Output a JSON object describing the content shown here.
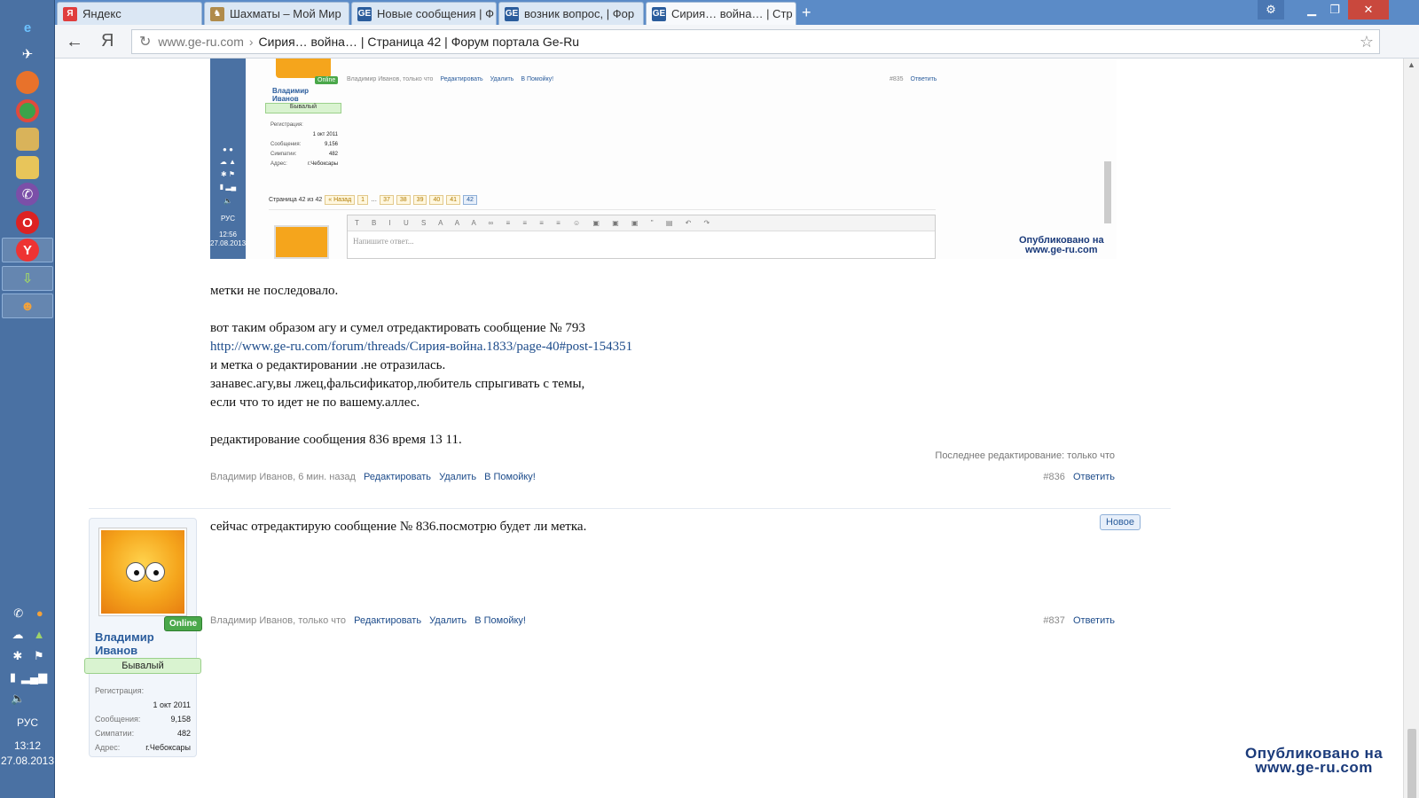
{
  "browser": {
    "tabs": [
      {
        "label": "Яндекс",
        "favicon": "Я",
        "favicon_color": "#e03d3d"
      },
      {
        "label": "Шахматы – Мой Мир",
        "favicon": "♞",
        "favicon_color": "#b08b4b"
      },
      {
        "label": "Новые сообщения | Ф",
        "favicon": "GE",
        "favicon_color": "#2a5c9c"
      },
      {
        "label": "возник вопрос, | Фор",
        "favicon": "GE",
        "favicon_color": "#2a5c9c"
      },
      {
        "label": "Сирия… война… | Стр",
        "favicon": "GE",
        "favicon_color": "#2a5c9c",
        "close": "✕"
      }
    ],
    "new_tab": "+",
    "address": {
      "domain": "www.ge-ru.com",
      "separator": "›",
      "title": "Сирия… война… | Страница 42 | Форум портала Ge-Ru"
    }
  },
  "taskbar": {
    "language": "РУС",
    "time": "13:12",
    "date": "27.08.2013"
  },
  "embedded": {
    "online": "Online",
    "name": "Владимир Иванов",
    "rank": "Бывалый",
    "stats": [
      {
        "label": "Регистрация:",
        "value": "1 окт 2011"
      },
      {
        "label": "Сообщения:",
        "value": "9,156"
      },
      {
        "label": "Симпатии:",
        "value": "482"
      },
      {
        "label": "Адрес:",
        "value": "г.Чебоксары"
      }
    ],
    "meta": "Владимир Иванов, только что",
    "edit": "Редактировать",
    "delete": "Удалить",
    "help": "В Помойку!",
    "post_num": "#835",
    "reply": "Ответить",
    "pager_label": "Страница 42 из 42",
    "pager_prev": "« Назад",
    "pages": [
      "1",
      "…",
      "37",
      "38",
      "39",
      "40",
      "41",
      "42"
    ],
    "placeholder": "Напишите ответ...",
    "language": "РУС",
    "time": "12:56",
    "date": "27.08.2013",
    "watermark_line1": "Опубликовано на",
    "watermark_line2": "www.ge-ru.com"
  },
  "post1": {
    "lines": [
      "метки не последовало.",
      "",
      "вот таким образом агу и сумел отредактировать сообщение № 793"
    ],
    "link": "http://www.ge-ru.com/forum/threads/Сирия-война.1833/page-40#post-154351",
    "lines2": [
      "и метка о редактировании .не отразилась.",
      "занавес.агу,вы лжец,фальсификатор,любитель спрыгивать с темы,",
      "если что то идет не по вашему.аллес.",
      "",
      "редактирование сообщения 836 время 13 11."
    ],
    "last_edit": "Последнее редактирование: только что",
    "meta": "Владимир Иванов, 6 мин. назад",
    "edit": "Редактировать",
    "delete": "Удалить",
    "help": "В Помойку!",
    "post_num": "#836",
    "reply": "Ответить"
  },
  "post2": {
    "text": "сейчас отредактирую сообщение № 836.посмотрю будет ли метка.",
    "new_badge": "Новое",
    "meta": "Владимир Иванов, только что",
    "edit": "Редактировать",
    "delete": "Удалить",
    "help": "В Помойку!",
    "post_num": "#837",
    "reply": "Ответить",
    "user": {
      "online": "Online",
      "name_line1": "Владимир",
      "name_line2": "Иванов",
      "rank": "Бывалый",
      "reg_label": "Регистрация:",
      "reg_value": "1 окт 2011",
      "msgs_label": "Сообщения:",
      "msgs_value": "9,158",
      "likes_label": "Симпатии:",
      "likes_value": "482",
      "addr_label": "Адрес:",
      "addr_value": "г.Чебоксары"
    }
  },
  "watermark": {
    "line1": "Опубликовано на",
    "line2": "www.ge-ru.com"
  },
  "colors": {
    "taskbar": "#4a71a3",
    "link": "#1c4b8a",
    "online": "#4aa84a",
    "rank_bg": "#d9f3d0"
  }
}
